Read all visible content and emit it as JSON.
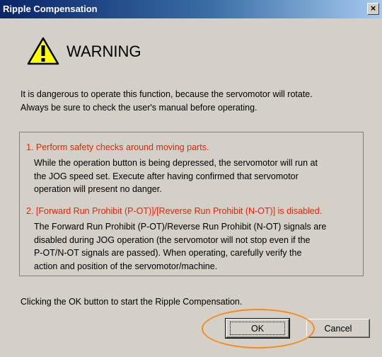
{
  "window": {
    "title": "Ripple Compensation",
    "close_label": "×"
  },
  "warning": {
    "icon": "warning-triangle-icon",
    "title": "WARNING",
    "intro_lines": [
      "It is dangerous to operate this function, because the servomotor will rotate.",
      "Always be sure to check the user's manual before operating."
    ]
  },
  "items": [
    {
      "heading": "1. Perform safety checks around moving parts.",
      "body_lines": [
        " While the operation button is being depressed, the servomotor will run at",
        "the JOG speed set. Execute after having confirmed that servomotor",
        "operation will present no danger."
      ]
    },
    {
      "heading": "2. [Forward Run Prohibit (P-OT)]/[Reverse Run Prohibit (N-OT)] is disabled.",
      "body_lines": [
        "The Forward Run Prohibit (P-OT)/Reverse Run Prohibit (N-OT) signals are",
        "disabled during JOG operation (the servomotor will not stop even if the",
        "P-OT/N-OT signals are passed). When operating, carefully verify the",
        "action and position of the servomotor/machine."
      ]
    }
  ],
  "footer": {
    "text": "Clicking the OK button to start the Ripple Compensation."
  },
  "buttons": {
    "ok_label": "OK",
    "cancel_label": "Cancel"
  },
  "colors": {
    "title_bar": "#0a246a",
    "dialog_bg": "#d4d0c8",
    "item_heading": "#e8230a",
    "highlight_ring": "#f58a1f",
    "warning_yellow": "#ffff00"
  }
}
